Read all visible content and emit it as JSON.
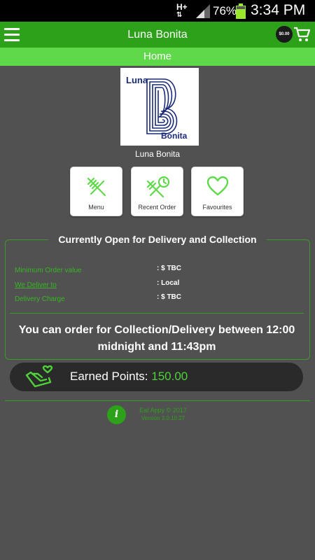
{
  "status_bar": {
    "network": "H+",
    "battery_percent": "76%",
    "time": "3:34 PM"
  },
  "app_bar": {
    "title": "Luna Bonita",
    "cart_amount": "$0.00"
  },
  "sub_bar": {
    "title": "Home"
  },
  "logo": {
    "line1": "Luna",
    "line2": "Bonita"
  },
  "restaurant": {
    "name": "Luna Bonita"
  },
  "tiles": [
    {
      "label": "Menu",
      "icon": "fork-knife-icon"
    },
    {
      "label": "Recent Order",
      "icon": "recent-order-icon"
    },
    {
      "label": "Favourites",
      "icon": "heart-icon"
    }
  ],
  "info": {
    "heading": "Currently Open for Delivery and Collection",
    "rows": [
      {
        "label": "Minimum Order value",
        "value": ": $ TBC"
      },
      {
        "label": "We Deliver to",
        "value": ": Local"
      },
      {
        "label": "Delivery Charge",
        "value": ": $ TBC"
      }
    ],
    "hours": "You can order for Collection/Delivery between 12:00 midnight and 11:43pm"
  },
  "points": {
    "label": "Earned Points:",
    "value": "150.00"
  },
  "footer": {
    "brand": "Eat Appy © 2017",
    "version": "Version 3.0.10.27"
  },
  "colors": {
    "primary_green": "#2ea11a",
    "light_green": "#5fd94a",
    "background": "#515151",
    "logo_blue": "#1a2a7a"
  }
}
